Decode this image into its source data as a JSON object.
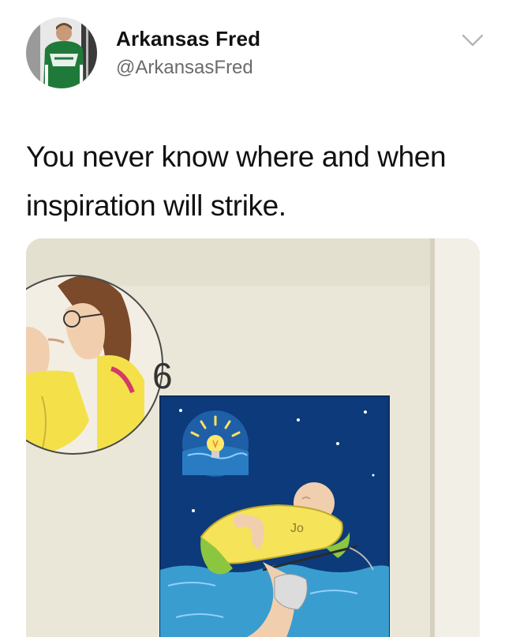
{
  "tweet": {
    "author_name": "Arkansas Fred",
    "author_handle": "@ArkansasFred",
    "text": "You never know where and when inspiration will strike.",
    "more_icon": "chevron-down-icon",
    "avatar_icon": "profile-photo"
  },
  "media": {
    "panel_number": "6",
    "ring_scribble": "Jo"
  },
  "colors": {
    "name": "#111111",
    "handle": "#6b6b6b",
    "panel_blue": "#0d3a7a",
    "water": "#3a9dd0",
    "float_yellow": "#f5e35a",
    "float_green": "#8cc63f"
  }
}
